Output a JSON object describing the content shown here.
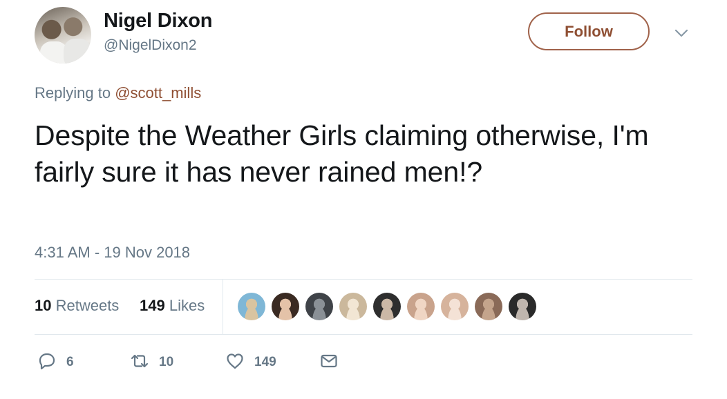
{
  "user": {
    "display_name": "Nigel Dixon",
    "handle": "@NigelDixon2"
  },
  "follow_label": "Follow",
  "reply": {
    "prefix": "Replying to ",
    "mention": "@scott_mills"
  },
  "tweet": {
    "text": "Despite the Weather Girls claiming otherwise, I'm fairly sure it has never rained men!?",
    "timestamp": "4:31 AM - 19 Nov 2018"
  },
  "stats": {
    "retweets_count": "10",
    "retweets_label": " Retweets",
    "likes_count": "149",
    "likes_label": " Likes"
  },
  "actions": {
    "reply_count": "6",
    "retweet_count": "10",
    "like_count": "149"
  },
  "icons": {
    "reply": "reply-icon",
    "retweet": "retweet-icon",
    "like": "heart-icon",
    "dm": "envelope-icon",
    "menu": "chevron-down-icon"
  },
  "colors": {
    "accent": "#8f4f33",
    "muted": "#657786",
    "text": "#14171a",
    "divider": "#e1e8ed"
  },
  "liker_avatars": [
    {
      "name": "liker-1",
      "bg": "#7fb7d6",
      "fg": "#d9c4a0"
    },
    {
      "name": "liker-2",
      "bg": "#3a2a22",
      "fg": "#e4c2a8"
    },
    {
      "name": "liker-3",
      "bg": "#3f4348",
      "fg": "#8a9096"
    },
    {
      "name": "liker-4",
      "bg": "#cbb89c",
      "fg": "#f2e6d4"
    },
    {
      "name": "liker-5",
      "bg": "#2e2e2e",
      "fg": "#cbb8a6"
    },
    {
      "name": "liker-6",
      "bg": "#c9a38c",
      "fg": "#f0d6c4"
    },
    {
      "name": "liker-7",
      "bg": "#d6b39c",
      "fg": "#f4e2d6"
    },
    {
      "name": "liker-8",
      "bg": "#8a6a58",
      "fg": "#c4a48c"
    },
    {
      "name": "liker-9",
      "bg": "#2a2a2a",
      "fg": "#c0b6ae"
    }
  ]
}
